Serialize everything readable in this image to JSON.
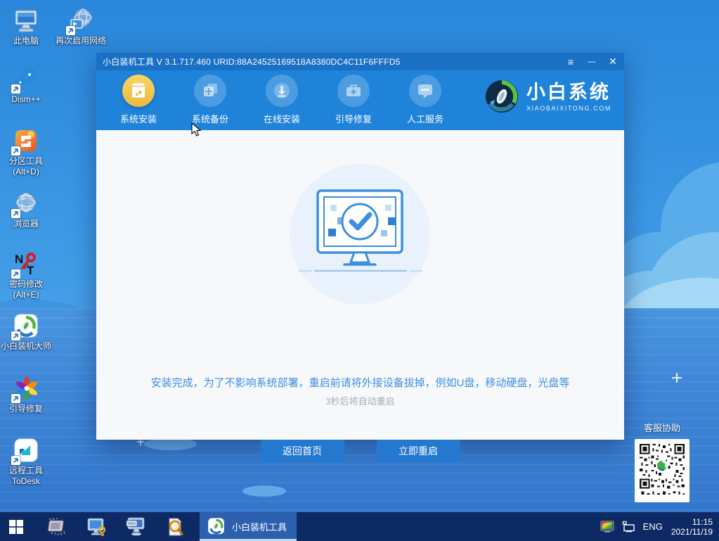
{
  "colors": {
    "titlebar": "#1a70c5",
    "tabbar": "#1f83da",
    "accent_blue": "#2478d0",
    "active_tab_yellow": "#ecb93e",
    "taskbar": "#0e2a64",
    "message_blue": "#3e8ee4"
  },
  "desktop": {
    "icons": [
      {
        "label": "此电脑",
        "label2": ""
      },
      {
        "label": "再次启用网络",
        "label2": ""
      },
      {
        "label": "Dism++",
        "label2": ""
      },
      {
        "label": "分区工具",
        "label2": "(Alt+D)"
      },
      {
        "label": "浏览器",
        "label2": ""
      },
      {
        "label": "密码修改",
        "label2": "(Alt+E)"
      },
      {
        "label": "小白装机大师",
        "label2": ""
      },
      {
        "label": "引导修复",
        "label2": ""
      },
      {
        "label": "远程工具",
        "label2": "ToDesk"
      }
    ],
    "password_icon_letters": {
      "n": "N",
      "t": "T"
    },
    "qr_panel": {
      "title": "客服协助"
    }
  },
  "window": {
    "title": "小白装机工具 V 3.1.717.460 URID:88A24525169518A8380DC4C11F6FFFD5",
    "controls": {
      "menu": "≡",
      "minimize": "—",
      "close": "✕"
    },
    "tabs": [
      {
        "label": "系统安装"
      },
      {
        "label": "系统备份"
      },
      {
        "label": "在线安装"
      },
      {
        "label": "引导修复"
      },
      {
        "label": "人工服务"
      }
    ],
    "brand": {
      "name": "小白系统",
      "site": "XIAOBAIXITONG.COM"
    },
    "content": {
      "message": "安装完成，为了不影响系统部署，重启前请将外接设备拔掉，例如U盘，移动硬盘，光盘等",
      "countdown": "3秒后将自动重启",
      "buttons": [
        {
          "label": "返回首页"
        },
        {
          "label": "立即重启"
        }
      ]
    }
  },
  "taskbar": {
    "active_app": {
      "label": "小白装机工具"
    },
    "tray": {
      "language": "ENG",
      "time": "11:15",
      "date": "2021/11/19"
    }
  }
}
